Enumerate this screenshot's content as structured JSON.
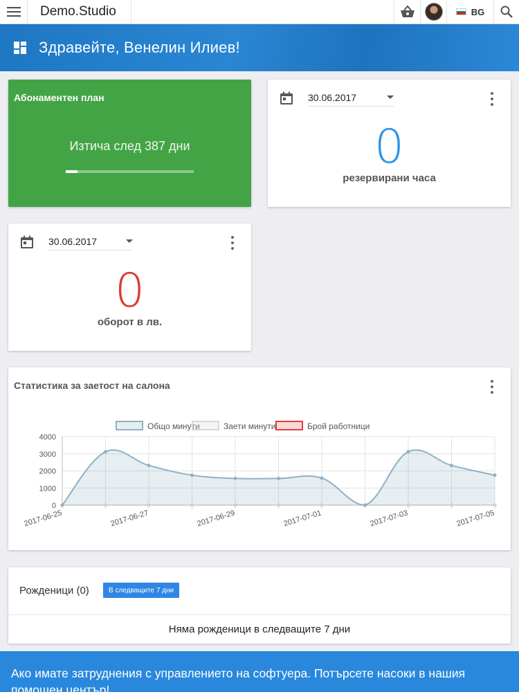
{
  "topbar": {
    "app_title": "Demo.Studio",
    "menu_icon": "hamburger-icon",
    "basket_icon": "basket-icon",
    "search_icon": "search-icon",
    "language": "BG",
    "flag_colors": [
      "#ffffff",
      "#00966e",
      "#d62612"
    ]
  },
  "header": {
    "greeting": "Здравейте, Венелин Илиев!",
    "icon": "dashboard-icon",
    "color": "#1e77c3"
  },
  "subscription": {
    "title": "Абонаментен план",
    "expires_text": "Изтича след 387 дни",
    "progress": 0.09,
    "color": "#43a446"
  },
  "booked_hours": {
    "date": "30.06.2017",
    "value": "0",
    "label": "резервирани часа",
    "color": "#2d95e6"
  },
  "turnover": {
    "date": "30.06.2017",
    "value": "0",
    "label": "оборот в лв.",
    "color": "#dc3b35"
  },
  "occupancy": {
    "title": "Статистика за заетост на салона"
  },
  "chart_data": {
    "type": "line",
    "title": "",
    "x": [
      "2017-06-25",
      "2017-06-26",
      "2017-06-27",
      "2017-06-28",
      "2017-06-29",
      "2017-06-30",
      "2017-07-01",
      "2017-07-02",
      "2017-07-03",
      "2017-07-04",
      "2017-07-05"
    ],
    "x_tick_labels": [
      "2017-06-25",
      "2017-06-27",
      "2017-06-29",
      "2017-07-01",
      "2017-07-03",
      "2017-07-05"
    ],
    "ylim": [
      0,
      4000
    ],
    "y_ticks": [
      "0",
      "1000",
      "2000",
      "3000",
      "4000"
    ],
    "grid": true,
    "legend_position": "top-center",
    "series": [
      {
        "name": "Общо минути",
        "values": [
          0,
          3120,
          2320,
          1750,
          1560,
          1560,
          1580,
          0,
          3120,
          2320,
          1750
        ],
        "color": "#8fb1c6",
        "fill": "rgba(143,177,198,0.22)"
      },
      {
        "name": "Заети минути",
        "values": [
          0,
          0,
          0,
          0,
          0,
          0,
          0,
          0,
          0,
          0,
          0
        ],
        "color": "#d8d8dc",
        "fill": "rgba(220,220,224,0.3)"
      },
      {
        "name": "Брой работници",
        "values": [
          0,
          0,
          0,
          0,
          0,
          0,
          0,
          0,
          0,
          0,
          0
        ],
        "color": "#e0413e",
        "fill": "rgba(240,160,160,0.4)"
      }
    ]
  },
  "birthdays": {
    "title": "Рожденици (0)",
    "badge": "В следващите 7 дни",
    "empty_text": "Няма рожденици в следващите 7 дни"
  },
  "footer": {
    "text": "Ако имате затруднения с управлението на софтуера. Потърсете насоки в нашия помощен център!"
  }
}
